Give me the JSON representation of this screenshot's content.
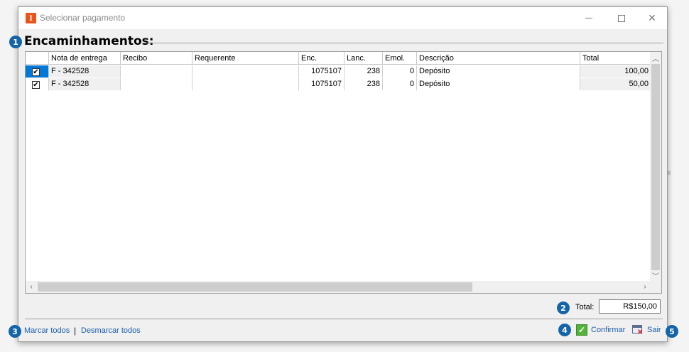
{
  "window": {
    "title": "Selecionar pagamento",
    "app_icon_letter": "I"
  },
  "section": {
    "title": "Encaminhamentos:"
  },
  "grid": {
    "columns": [
      "",
      "Nota de entrega",
      "Recibo",
      "Requerente",
      "Enc.",
      "Lanc.",
      "Emol.",
      "Descrição",
      "Total"
    ],
    "rows": [
      {
        "checked": true,
        "nota": "F - 342528",
        "recibo": "",
        "requerente": "",
        "enc": "1075107",
        "lanc": "238",
        "emol": "0",
        "descricao": "Depósito",
        "total": "100,00"
      },
      {
        "checked": true,
        "nota": "F - 342528",
        "recibo": "",
        "requerente": "",
        "enc": "1075107",
        "lanc": "238",
        "emol": "0",
        "descricao": "Depósito",
        "total": "50,00"
      }
    ]
  },
  "footer": {
    "total_label": "Total:",
    "total_value": "R$150,00",
    "mark_all": "Marcar todos",
    "separator": "|",
    "unmark_all": "Desmarcar todos",
    "confirm": "Confirmar",
    "exit": "Sair"
  },
  "badges": [
    "1",
    "2",
    "3",
    "4",
    "5"
  ],
  "colors": {
    "badge": "#1564a8",
    "link": "#1b5dac",
    "selected": "#0078d7",
    "app_icon": "#e8541c"
  }
}
